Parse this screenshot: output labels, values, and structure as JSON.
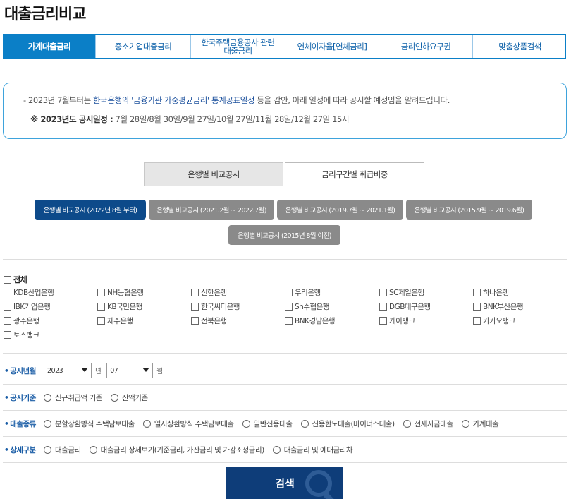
{
  "page": {
    "title": "대출금리비교"
  },
  "tabs": [
    {
      "label": "가계대출금리"
    },
    {
      "label": "중소기업대출금리"
    },
    {
      "label": "한국주택금융공사 관련\n대출금리"
    },
    {
      "label": "연체이자율[연체금리]"
    },
    {
      "label": "금리인하요구권"
    },
    {
      "label": "맞춤상품검색"
    }
  ],
  "notice": {
    "line1_prefix": "- 2023년 7월부터는 ",
    "line1_highlight": "한국은행의 '금융기관 가중평균금리' 통계공표일정",
    "line1_suffix": " 등을 감안, 아래 일정에 따라 공시할 예정임을 알려드립니다.",
    "line2_label": "※ 2023년도 공시일정 :",
    "line2_value": " 7월 28일/8월 30일/9월 27일/10월 27일/11월 28일/12월 27일 15시"
  },
  "view_toggle": {
    "bank": "은행별 비교공시",
    "range": "금리구간별 취급비중"
  },
  "periods": [
    {
      "label": "은행별 비교공시 (2022년 8월 부터)"
    },
    {
      "label": "은행별 비교공시 (2021.2월 ~ 2022.7월)"
    },
    {
      "label": "은행별 비교공시 (2019.7월 ~ 2021.1월)"
    },
    {
      "label": "은행별 비교공시 (2015.9월 ~ 2019.6월)"
    },
    {
      "label": "은행별 비교공시 (2015년 8월 이전)"
    }
  ],
  "banks": {
    "all": "전체",
    "list": [
      "KDB산업은행",
      "NH농협은행",
      "신한은행",
      "우리은행",
      "SC제일은행",
      "하나은행",
      "IBK기업은행",
      "KB국민은행",
      "한국씨티은행",
      "Sh수협은행",
      "DGB대구은행",
      "BNK부산은행",
      "광주은행",
      "제주은행",
      "전북은행",
      "BNK경남은행",
      "케이뱅크",
      "카카오뱅크",
      "토스뱅크"
    ]
  },
  "filters": {
    "date": {
      "label": "공시년월",
      "year": "2023",
      "year_unit": "년",
      "month": "07",
      "month_unit": "월"
    },
    "basis": {
      "label": "공시기준",
      "options": [
        "신규취급액 기준",
        "잔액기준"
      ]
    },
    "loan_type": {
      "label": "대출종류",
      "options": [
        "분할상환방식 주택담보대출",
        "일시상환방식 주택담보대출",
        "일반신용대출",
        "신용한도대출(마이너스대출)",
        "전세자금대출",
        "가계대출"
      ]
    },
    "detail": {
      "label": "상세구분",
      "options": [
        "대출금리",
        "대출금리 상세보기(기준금리, 가산금리 및 가감조정금리)",
        "대출금리 및 예대금리차"
      ]
    }
  },
  "search": {
    "label": "검색"
  }
}
